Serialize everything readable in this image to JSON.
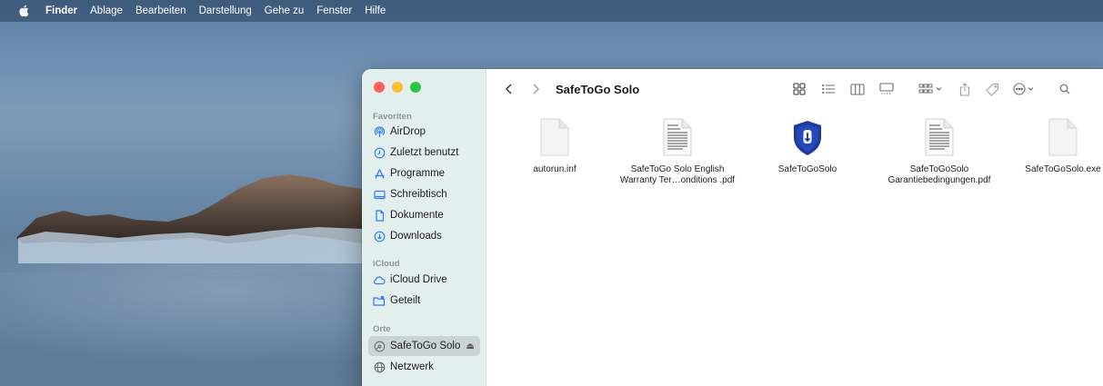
{
  "menubar": {
    "apple_icon": "apple-logo-icon",
    "items": [
      "Finder",
      "Ablage",
      "Bearbeiten",
      "Darstellung",
      "Gehe zu",
      "Fenster",
      "Hilfe"
    ]
  },
  "window": {
    "title": "SafeToGo Solo",
    "traffic_lights": {
      "close": "#ff5f57",
      "minimize": "#febc2e",
      "zoom": "#28c840"
    }
  },
  "sidebar": {
    "sections": [
      {
        "title": "Favoriten",
        "items": [
          {
            "label": "AirDrop",
            "icon": "airdrop-icon"
          },
          {
            "label": "Zuletzt benutzt",
            "icon": "clock-icon"
          },
          {
            "label": "Programme",
            "icon": "applications-icon"
          },
          {
            "label": "Schreibtisch",
            "icon": "desktop-icon"
          },
          {
            "label": "Dokumente",
            "icon": "document-icon"
          },
          {
            "label": "Downloads",
            "icon": "download-icon"
          }
        ]
      },
      {
        "title": "iCloud",
        "items": [
          {
            "label": "iCloud Drive",
            "icon": "cloud-icon"
          },
          {
            "label": "Geteilt",
            "icon": "shared-folder-icon"
          }
        ]
      },
      {
        "title": "Orte",
        "items": [
          {
            "label": "SafeToGo Solo",
            "icon": "drive-icon",
            "selected": true,
            "eject": "⏏"
          },
          {
            "label": "Netzwerk",
            "icon": "network-icon"
          }
        ]
      }
    ]
  },
  "toolbar": {
    "icons": [
      "back-icon",
      "forward-icon",
      "icon-view-icon",
      "list-view-icon",
      "column-view-icon",
      "gallery-view-icon",
      "group-icon",
      "share-icon",
      "tag-icon",
      "more-icon",
      "search-icon"
    ]
  },
  "files": [
    {
      "name": "autorun.inf",
      "kind": "blank-document-icon"
    },
    {
      "name_line1": "SafeToGo Solo English",
      "name_line2": "Warranty Ter…onditions .pdf",
      "kind": "pdf-document-icon"
    },
    {
      "name": "SafeToGoSolo",
      "kind": "app-shield-icon",
      "accent": "#1d3a9c"
    },
    {
      "name_line1": "SafeToGoSolo",
      "name_line2": "Garantiebedingungen.pdf",
      "kind": "pdf-document-icon"
    },
    {
      "name": "SafeToGoSolo.exe",
      "kind": "blank-document-icon"
    }
  ]
}
